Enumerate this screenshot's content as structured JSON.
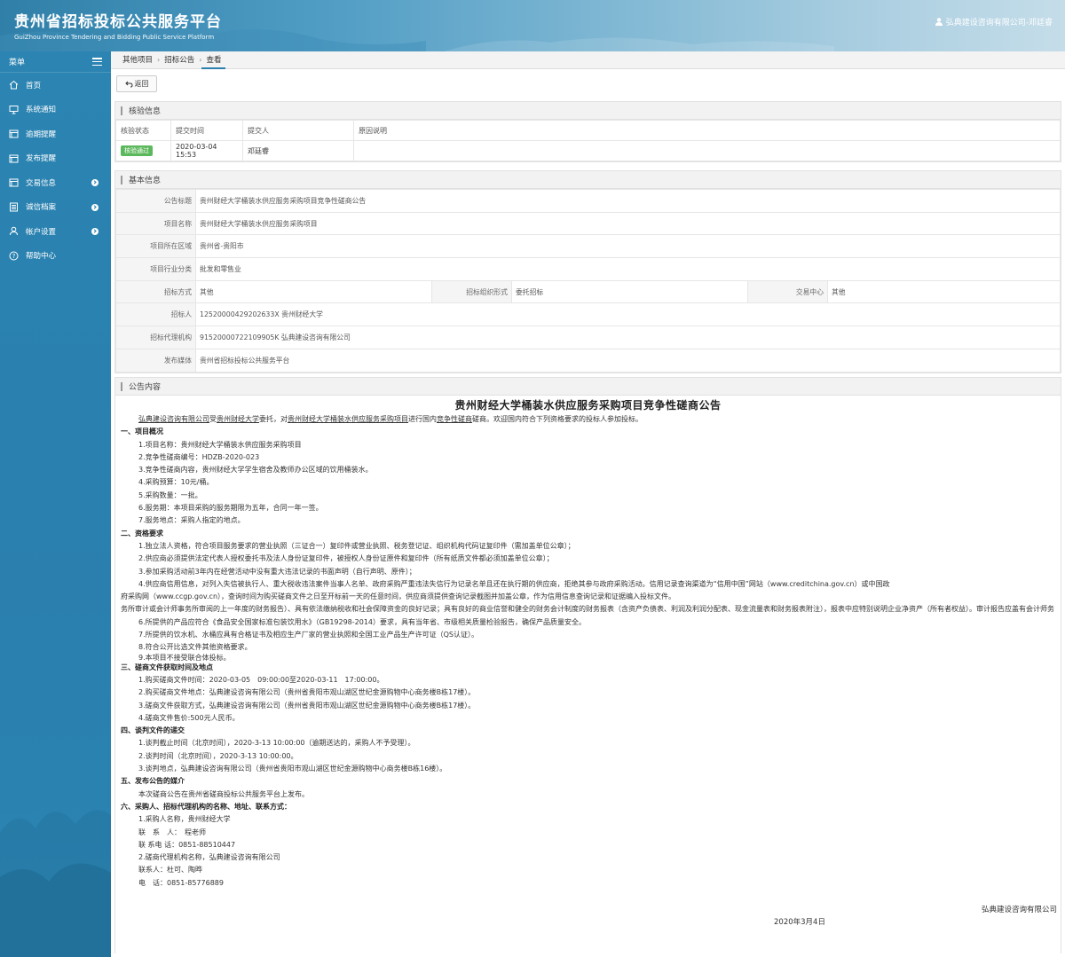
{
  "header": {
    "title_cn": "贵州省招标投标公共服务平台",
    "title_en": "GuiZhou Province Tendering and Bidding Public Service Platform",
    "user": "弘典建设咨询有限公司-邓廷睿"
  },
  "sidebar": {
    "menu_label": "菜单",
    "items": [
      {
        "label": "首页",
        "icon": "home-icon"
      },
      {
        "label": "系统通知",
        "icon": "monitor-icon"
      },
      {
        "label": "逾期提醒",
        "icon": "calendar-icon"
      },
      {
        "label": "发布提醒",
        "icon": "calendar-icon"
      },
      {
        "label": "交易信息",
        "icon": "calendar-icon"
      },
      {
        "label": "诚信档案",
        "icon": "list-icon"
      },
      {
        "label": "帐户设置",
        "icon": "user-icon"
      },
      {
        "label": "帮助中心",
        "icon": "help-icon"
      }
    ]
  },
  "breadcrumb": [
    "其他项目",
    "招标公告",
    "查看"
  ],
  "back_label": "返回",
  "review": {
    "title": "核验信息",
    "headers": [
      "核验状态",
      "提交时间",
      "提交人",
      "原因说明"
    ],
    "row": {
      "status": "核验通过",
      "time": "2020-03-04 15:53",
      "person": "邓廷睿",
      "reason": ""
    }
  },
  "basic": {
    "title": "基本信息",
    "notice_title_label": "公告标题",
    "notice_title": "贵州财经大学桶装水供应服务采购项目竞争性磋商公告",
    "project_name_label": "项目名称",
    "project_name": "贵州财经大学桶装水供应服务采购项目",
    "region_label": "项目所在区域",
    "region": "贵州省-贵阳市",
    "industry_label": "项目行业分类",
    "industry": "批发和零售业",
    "method_label": "招标方式",
    "method": "其他",
    "org_form_label": "招标组织形式",
    "org_form": "委托招标",
    "center_label": "交易中心",
    "center": "其他",
    "tenderer_label": "招标人",
    "tenderer": "125200004292026​33X 贵州财经大学",
    "agent_label": "招标代理机构",
    "agent": "91520000722109905K 弘典建设咨询有限公司",
    "media_label": "发布媒体",
    "media": "贵州省招标投标公共服务平台"
  },
  "notice": {
    "panel_title": "公告内容",
    "title": "贵州财经大学桶装水供应服务采购项目竞争性磋商公告",
    "intro_a": "弘典建设咨询有限公司",
    "intro_b": "受",
    "intro_c": "贵州财经大学",
    "intro_d": "委托，对",
    "intro_e": "贵州财经大学桶装水供应服务采购项目",
    "intro_f": "进行国内",
    "intro_g": "竞争性磋商",
    "intro_h": "磋商。欢迎国内符合下列资格要求的投标人参加投标。",
    "s1": "一、项目概况",
    "s1_lines": [
      "1.项目名称：贵州财经大学桶装水供应服务采购项目",
      "2.竞争性磋商编号：HDZB-2020-023",
      "3.竞争性磋商内容，贵州财经大学学生宿舍及教师办公区域的饮用桶装水。",
      "4.采购预算：10元/桶。",
      "5.采购数量：一批。",
      "6.服务期：本项目采购的服务期限为五年，合同一年一签。",
      "7.服务地点：采购人指定的地点。"
    ],
    "s2": "二、资格要求",
    "s2_lines": [
      "1.独立法人资格，符合项目服务要求的营业执照（三证合一）复印件或营业执照、税务登记证、组织机构代码证复印件（需加盖单位公章）；",
      "2.供应商必须提供法定代表人授权委托书及法人身份证复印件，被授权人身份证原件和复印件（所有纸质文件都必须加盖单位公章）；",
      "3.参加采购活动前3年内在经营活动中没有重大违法记录的书面声明（自行声明、原件）；",
      "4.供应商信用信息，对列入失信被执行人、重大税收违法案件当事人名单、政府采购严重违法失信行为记录名单且还在执行期的供应商，拒绝其参与政府采购活动。信用记录查询渠道为“信用中国”网站（www.creditchina.gov.cn）或中国政",
      "府采购网（www.ccgp.gov.cn），查询时间为购买磋商文件之日至开标前一天的任意时间，供应商须提供查询记录截图并加盖公章，作为信用信息查询记录和证据编入投标文件。",
      "务所审计或会计师事务所审阅的上一年度的财务报告）、具有依法缴纳税收和社会保障资金的良好记录；具有良好的商业信誉和健全的财务会计制度的财务报表（含资产负债表、利润及利润分配表、现金流量表和财务报表附注），报表中应特别说明企业净资产（所有者权益）。审计报告应盖有会计师务",
      "6.所提供的产品应符合《食品安全国家标准包装饮用水》（GB19298-2014）要求，具有当年省、市级相关质量检验报告，确保产品质量安全。",
      "7.所提供的饮水机、水桶应具有合格证书及相应生产厂家的营业执照和全国工业产品生产许可证（QS认证）。",
      "8.符合公开比选文件其他资格要求。",
      "9.本项目不接受联合体投标。"
    ],
    "s3": "三、磋商文件获取时间及地点",
    "s3_lines": [
      "1.购买磋商文件时间：2020-03-05　09:00:00至2020-03-11　17:00:00。",
      "2.购买磋商文件地点：弘典建设咨询有限公司（贵州省贵阳市观山湖区世纪金源购物中心商务楼B栋17楼）。",
      "3.磋商文件获取方式，弘典建设咨询有限公司（贵州省贵阳市观山湖区世纪金源购物中心商务楼B栋17楼）。",
      "4.磋商文件售价:500元人民币。"
    ],
    "s4": "四、谈判文件的递交",
    "s4_lines": [
      "1.谈判截止时间（北京时间），2020-3-13 10:00:00（逾期送达的，采购人不予受理）。",
      "2.谈判时间（北京时间），2020-3-13 10:00:00。",
      "3.谈判地点，弘典建设咨询有限公司（贵州省贵阳市观山湖区世纪金源购物中心商务楼B栋16楼）。"
    ],
    "s5": "五、发布公告的媒介",
    "s5_lines": [
      "本次磋商公告在贵州省磋商投标公共服务平台上发布。"
    ],
    "s6": "六、采购人、招标代理机构的名称、地址、联系方式：",
    "s6_lines": [
      "1.采购人名称，贵州财经大学",
      "联　系　人：　程老师",
      "联 系电 话：0851-88510447",
      "2.磋商代理机构名称，弘典建设咨询有限公司",
      "联系人：杜可、陶晔",
      "电　话：0851-85776889"
    ],
    "sign_company": "弘典建设咨询有限公司",
    "sign_date": "2020年3月4日"
  }
}
